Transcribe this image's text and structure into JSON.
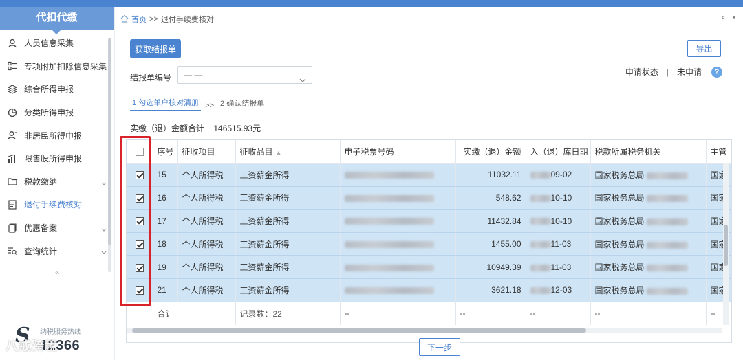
{
  "sidebar": {
    "title": "代扣代缴",
    "items": [
      {
        "label": "人员信息采集",
        "icon": "person-icon",
        "expandable": false,
        "active": false
      },
      {
        "label": "专项附加扣除信息采集",
        "icon": "list-icon",
        "expandable": false,
        "active": false
      },
      {
        "label": "综合所得申报",
        "icon": "layers-icon",
        "expandable": false,
        "active": false
      },
      {
        "label": "分类所得申报",
        "icon": "pie-chart-icon",
        "expandable": false,
        "active": false
      },
      {
        "label": "非居民所得申报",
        "icon": "person-outline-icon",
        "expandable": false,
        "active": false
      },
      {
        "label": "限售股所得申报",
        "icon": "bar-chart-icon",
        "expandable": false,
        "active": false
      },
      {
        "label": "税款缴纳",
        "icon": "folder-icon",
        "expandable": true,
        "active": false
      },
      {
        "label": "退付手续费核对",
        "icon": "document-list-icon",
        "expandable": false,
        "active": true
      },
      {
        "label": "优惠备案",
        "icon": "document-icon",
        "expandable": true,
        "active": false
      },
      {
        "label": "查询统计",
        "icon": "search-list-icon",
        "expandable": true,
        "active": false
      }
    ],
    "collapse_label": "«",
    "hotline_label": "纳税服务热线",
    "hotline_number": "12366"
  },
  "breadcrumb": {
    "home": "首页",
    "separator": ">>",
    "current": "退付手续费核对"
  },
  "window_controls": {
    "restore": "▫",
    "close": "×"
  },
  "toolbar": {
    "fetch_button": "获取结报单",
    "export_button": "导出"
  },
  "filter": {
    "label": "结报单编号",
    "value": "— —"
  },
  "status": {
    "label": "申请状态",
    "divider": "|",
    "value": "未申请",
    "help": "?"
  },
  "steps": {
    "step1": "1 勾选单户核对清册",
    "separator": ">>",
    "step2": "2 确认结报单"
  },
  "summary": {
    "label": "实缴（退）金额合计",
    "amount": "146515.93元"
  },
  "table": {
    "columns": [
      "序号",
      "征收项目",
      "征收品目",
      "电子税票号码",
      "实缴（退）金额",
      "入（退）库日期",
      "税款所属税务机关",
      "主管"
    ],
    "rows": [
      {
        "seq": "15",
        "item": "个人所得税",
        "category": "工资薪金所得",
        "amount": "11032.11",
        "date": "09-02",
        "office": "国家税务总局",
        "chief": "国家",
        "checked": true
      },
      {
        "seq": "16",
        "item": "个人所得税",
        "category": "工资薪金所得",
        "amount": "548.62",
        "date": "10-10",
        "office": "国家税务总局",
        "chief": "国家",
        "checked": true
      },
      {
        "seq": "17",
        "item": "个人所得税",
        "category": "工资薪金所得",
        "amount": "11432.84",
        "date": "10-10",
        "office": "国家税务总局",
        "chief": "国家",
        "checked": true
      },
      {
        "seq": "18",
        "item": "个人所得税",
        "category": "工资薪金所得",
        "amount": "1455.00",
        "date": "11-03",
        "office": "国家税务总局",
        "chief": "国家",
        "checked": true
      },
      {
        "seq": "19",
        "item": "个人所得税",
        "category": "工资薪金所得",
        "amount": "10949.39",
        "date": "11-03",
        "office": "国家税务总局",
        "chief": "国家",
        "checked": true
      },
      {
        "seq": "21",
        "item": "个人所得税",
        "category": "工资薪金所得",
        "amount": "3621.18",
        "date": "12-03",
        "office": "国家税务总局",
        "chief": "国家",
        "checked": true
      }
    ],
    "footer": {
      "label": "合计",
      "count": "记录数：22",
      "dash": "--"
    }
  },
  "footer": {
    "next_button": "下一步"
  },
  "watermark": "八戒跨境",
  "colors": {
    "accent": "#4a83cf",
    "row_highlight": "#cfe4f5",
    "annotation_red": "#d8232a"
  }
}
